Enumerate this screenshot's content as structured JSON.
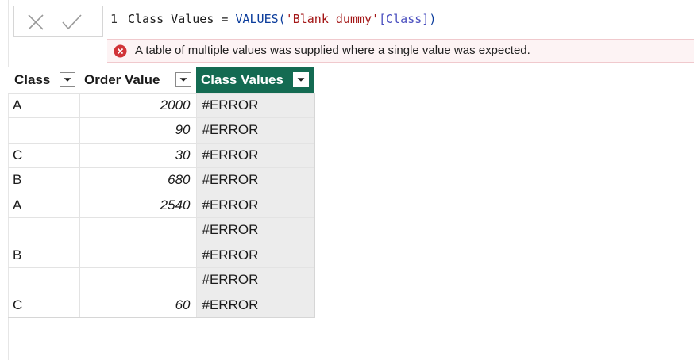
{
  "formula": {
    "line_number": "1",
    "measure_name": "Class Values",
    "operator": " = ",
    "function": "VALUES",
    "open_paren": "(",
    "table_ref": "'Blank dummy'",
    "column_ref": "[Class]",
    "close_paren": ")"
  },
  "error": {
    "message": "A table of multiple values was supplied where a single value was expected.",
    "color": "#d13438"
  },
  "table": {
    "headers": [
      "Class",
      "Order Value",
      "Class Values"
    ],
    "active_column": "Class Values",
    "accent_color": "#146b52",
    "rows": [
      {
        "class": "A",
        "order_value": "2000",
        "class_values": "#ERROR"
      },
      {
        "class": "",
        "order_value": "90",
        "class_values": "#ERROR"
      },
      {
        "class": "C",
        "order_value": "30",
        "class_values": "#ERROR"
      },
      {
        "class": "B",
        "order_value": "680",
        "class_values": "#ERROR"
      },
      {
        "class": "A",
        "order_value": "2540",
        "class_values": "#ERROR"
      },
      {
        "class": "",
        "order_value": "",
        "class_values": "#ERROR"
      },
      {
        "class": "B",
        "order_value": "",
        "class_values": "#ERROR"
      },
      {
        "class": "",
        "order_value": "",
        "class_values": "#ERROR"
      },
      {
        "class": "C",
        "order_value": "60",
        "class_values": "#ERROR"
      }
    ]
  }
}
